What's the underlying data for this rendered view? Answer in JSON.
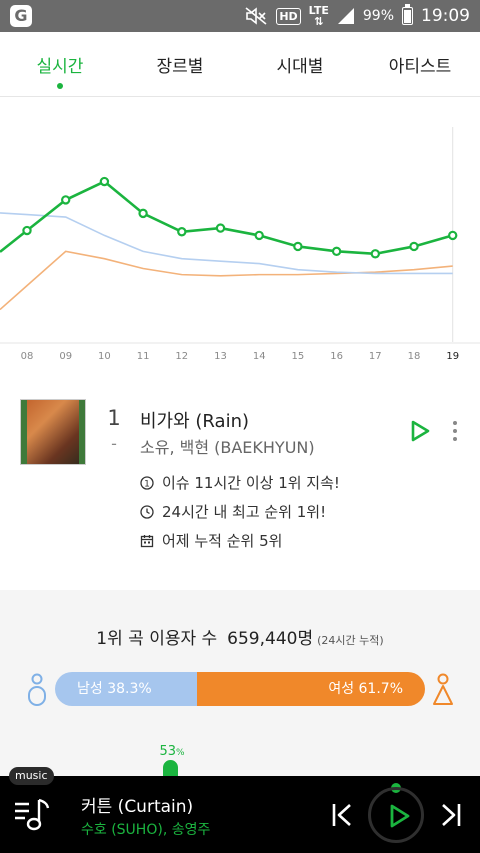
{
  "status_bar": {
    "app_icon": "G",
    "hd": "HD",
    "lte": "LTE",
    "battery": "99%",
    "battery_level": 0.99,
    "time": "19:09"
  },
  "tabs": [
    {
      "label": "실시간",
      "active": true
    },
    {
      "label": "장르별",
      "active": false
    },
    {
      "label": "시대별",
      "active": false
    },
    {
      "label": "아티스트",
      "active": false
    }
  ],
  "chart_data": {
    "type": "line",
    "x": [
      "08",
      "09",
      "10",
      "11",
      "12",
      "13",
      "14",
      "15",
      "16",
      "17",
      "18",
      "19"
    ],
    "series": [
      {
        "color": "#1bb43f",
        "values": [
          45.5,
          58,
          65.5,
          52.5,
          45,
          46.5,
          43.5,
          39,
          37,
          36,
          39,
          43.5
        ]
      },
      {
        "color": "#b5cff0",
        "values": [
          52,
          51,
          43.5,
          37,
          34,
          33,
          32,
          29.5,
          28.5,
          28,
          28,
          28
        ]
      },
      {
        "color": "#f3b27a",
        "values": [
          23,
          37,
          34,
          30,
          27.5,
          27,
          27.5,
          27.5,
          28,
          28.5,
          29.5,
          31
        ]
      }
    ],
    "ylim": [
      0,
      100
    ],
    "highlighted_x": "19",
    "grid": false
  },
  "song": {
    "rank": "1",
    "rank_change": "-",
    "title": "비가와 (Rain)",
    "artist": "소유, 백현 (BAEKHYUN)",
    "info": [
      {
        "icon": "medal-icon",
        "text": "이슈 11시간 이상 1위 지속!"
      },
      {
        "icon": "clock-icon",
        "text": "24시간 내 최고 순위 1위!"
      },
      {
        "icon": "calendar-icon",
        "text": "어제 누적 순위 5위"
      }
    ]
  },
  "stats": {
    "title": "1위 곡 이용자 수",
    "count": "659,440명",
    "note": "(24시간 누적)",
    "male_label": "남성 38.3%",
    "female_label": "여성 61.7%",
    "male_fraction": 0.383,
    "age_value": "53",
    "age_unit": "%"
  },
  "player": {
    "tag": "music",
    "title": "커튼 (Curtain)",
    "artist": "수호 (SUHO), 송영주"
  }
}
